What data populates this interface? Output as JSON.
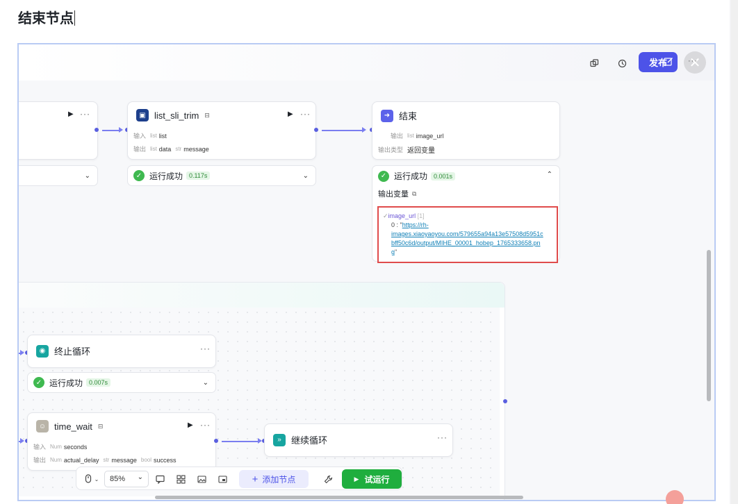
{
  "page": {
    "heading": "结束节点"
  },
  "topbar": {
    "publish_label": "发布",
    "close_symbol": "✕",
    "icons": [
      "copy-icon",
      "history-icon",
      "edit-icon",
      "more-icon"
    ]
  },
  "nodes": {
    "partial_left": {
      "status_chevron": "⌄"
    },
    "list_sli_trim": {
      "title": "list_sli_trim",
      "input_label": "输入",
      "input_type": "list",
      "input_name": "list",
      "output_label": "输出",
      "output_1_type": "list",
      "output_1_name": "data",
      "output_2_type": "str",
      "output_2_name": "message",
      "status": "运行成功",
      "duration": "0.117s"
    },
    "end": {
      "title": "结束",
      "output_label": "输出",
      "output_type": "list",
      "output_name": "image_url",
      "output_kind_label": "输出类型",
      "output_kind_value": "返回变量",
      "status": "运行成功",
      "duration": "0.001s",
      "output_var_title": "输出变量",
      "var_key": "image_url",
      "var_count": "[1]",
      "item_index": "0 : \"",
      "url_line_1": "https://rh-",
      "url_line_2": "images.xiaoyaoyou.com/579655a94a13e57508d5951c",
      "url_line_3": "bff50c6d/output/MIHE_00001_hobep_1765333658.pn",
      "url_line_4": "g",
      "url_close": "\""
    },
    "stop_loop": {
      "title": "终止循环",
      "status": "运行成功",
      "duration": "0.007s"
    },
    "time_wait": {
      "title": "time_wait",
      "input_label": "输入",
      "input_type": "Num",
      "input_name": "seconds",
      "output_label": "输出",
      "output_1_type": "Num",
      "output_1_name": "actual_delay",
      "output_2_type": "str",
      "output_2_name": "message",
      "output_3_type": "bool",
      "output_3_name": "success"
    },
    "continue_loop": {
      "title": "继续循环"
    }
  },
  "bottom_toolbar": {
    "zoom": "85%",
    "add_node_label": "添加节点",
    "test_run_label": "试运行"
  },
  "colors": {
    "accent": "#4d53e8",
    "success": "#1fae3e",
    "highlight_border": "#e04b4b"
  }
}
